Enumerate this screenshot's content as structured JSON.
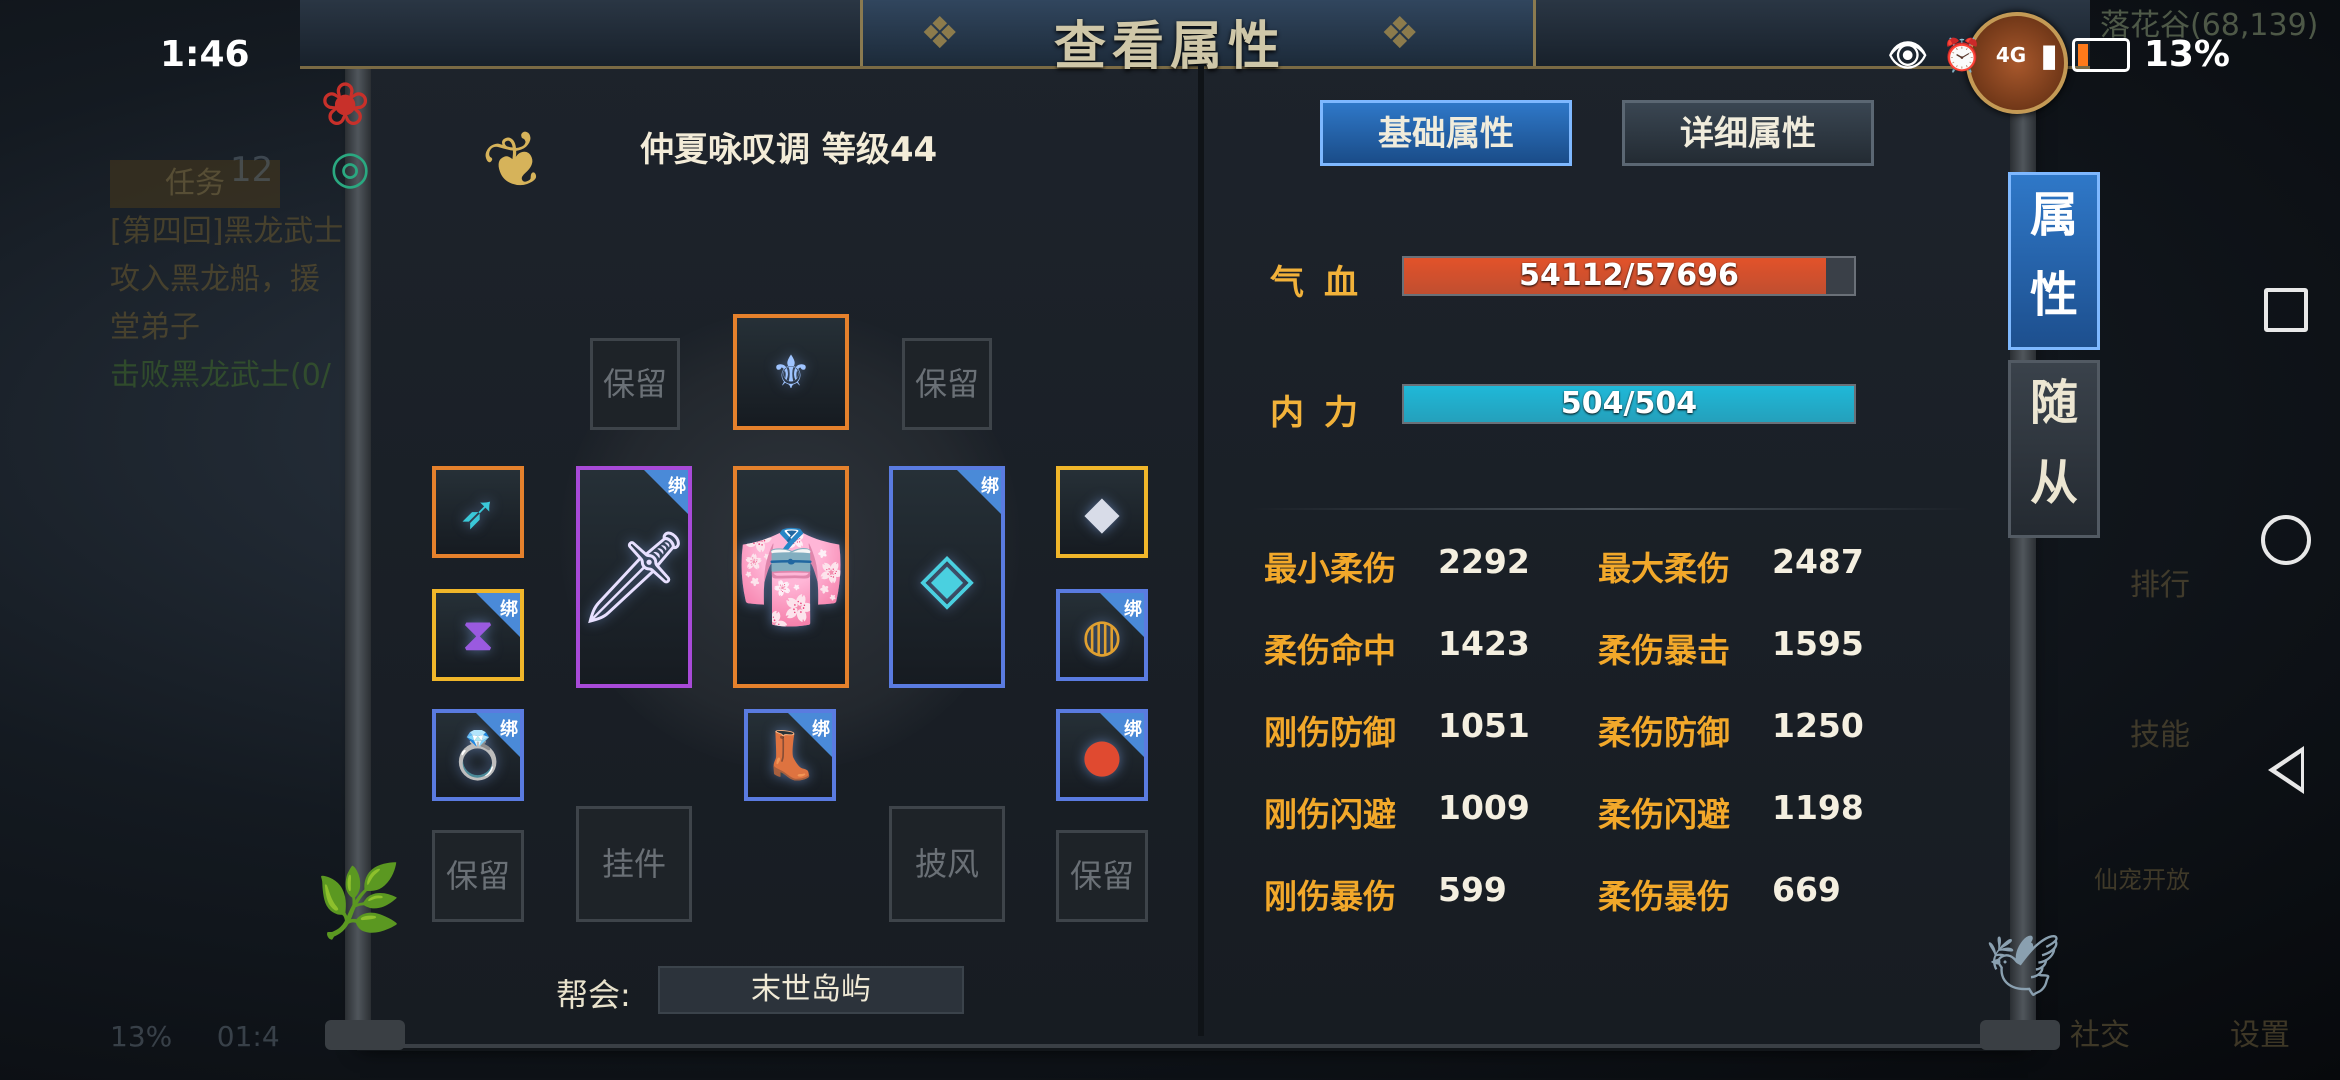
{
  "status_bar": {
    "time": "1:46",
    "network": "4G",
    "battery": "13%",
    "icons": [
      "eye-icon",
      "alarm-icon",
      "signal-icon",
      "battery-icon"
    ]
  },
  "background": {
    "quest_tab": "任务",
    "quest_lines": [
      "[第四回]黑龙武士",
      "攻入黑龙船，援",
      "堂弟子",
      "击败黑龙武士(0/"
    ],
    "bottom_status": "13%",
    "bottom_time": "01:4",
    "coords": "落花谷(68,139)",
    "level_badge": "12",
    "right_labels": [
      "排行",
      "技能",
      "仙宠开放",
      "社交",
      "设置"
    ]
  },
  "panel": {
    "title": "查看属性",
    "character": {
      "name_line": "仲夏咏叹调 等级44"
    },
    "slots": {
      "reserved_label": "保留",
      "pendant_label": "挂件",
      "cloak_label": "披风",
      "bind_badge": "绑"
    },
    "guild": {
      "label": "帮会:",
      "value": "末世岛屿"
    }
  },
  "tabs": {
    "basic": "基础属性",
    "detail": "详细属性"
  },
  "side_tabs": {
    "attributes": [
      "属",
      "性"
    ],
    "follower": [
      "随",
      "从"
    ]
  },
  "bars": {
    "hp": {
      "label": "气血",
      "text": "54112/57696",
      "current": 54112,
      "max": 57696,
      "color": "#e2522a"
    },
    "mp": {
      "label": "内力",
      "text": "504/504",
      "current": 504,
      "max": 504,
      "color": "#1fb8d8"
    }
  },
  "stats": [
    {
      "name": "最小柔伤",
      "value": "2292"
    },
    {
      "name": "最大柔伤",
      "value": "2487"
    },
    {
      "name": "柔伤命中",
      "value": "1423"
    },
    {
      "name": "柔伤暴击",
      "value": "1595"
    },
    {
      "name": "刚伤防御",
      "value": "1051"
    },
    {
      "name": "柔伤防御",
      "value": "1250"
    },
    {
      "name": "刚伤闪避",
      "value": "1009"
    },
    {
      "name": "柔伤闪避",
      "value": "1198"
    },
    {
      "name": "刚伤暴伤",
      "value": "599"
    },
    {
      "name": "柔伤暴伤",
      "value": "669"
    }
  ]
}
